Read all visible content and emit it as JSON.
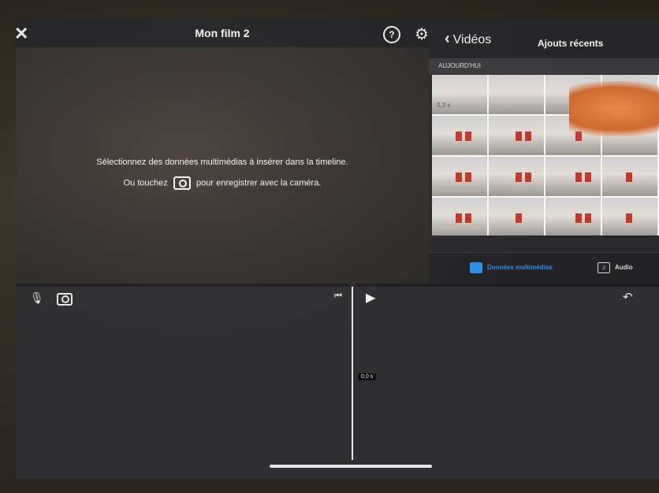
{
  "header": {
    "close_icon": "close-icon",
    "title": "Mon film 2",
    "help_icon": "help-icon",
    "settings_icon": "gear-icon"
  },
  "viewer": {
    "hint_line1": "Sélectionnez des données multimédias à insérer dans la timeline.",
    "hint_line2_prefix": "Ou touchez",
    "hint_line2_suffix": "pour enregistrer avec la caméra."
  },
  "browser": {
    "back_label": "Vidéos",
    "collection_title": "Ajouts récents",
    "section_header": "AUJOURD'HUI",
    "thumbnail_duration": "0,3 s",
    "tabs": [
      {
        "label": "Données multimédias",
        "selected": true
      },
      {
        "label": "Audio",
        "selected": false
      }
    ]
  },
  "timeline": {
    "playhead_time": "0,0 s"
  },
  "colors": {
    "accent": "#2f8ee8",
    "background": "#2b2b2e"
  }
}
